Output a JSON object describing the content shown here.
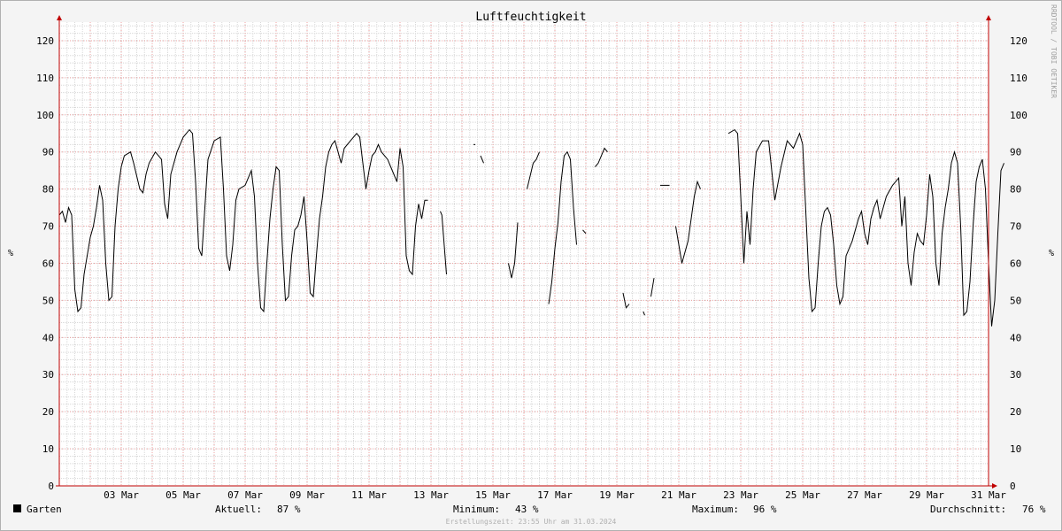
{
  "chart_data": {
    "type": "line",
    "title": "Luftfeuchtigkeit",
    "ylabel": "%",
    "ylim": [
      0,
      125
    ],
    "yticks": [
      0,
      10,
      20,
      30,
      40,
      50,
      60,
      70,
      80,
      90,
      100,
      110,
      120
    ],
    "xlim": [
      0,
      30
    ],
    "x_ticks": [
      {
        "day": 2,
        "label": "03 Mar"
      },
      {
        "day": 4,
        "label": "05 Mar"
      },
      {
        "day": 6,
        "label": "07 Mar"
      },
      {
        "day": 8,
        "label": "09 Mar"
      },
      {
        "day": 10,
        "label": "11 Mar"
      },
      {
        "day": 12,
        "label": "13 Mar"
      },
      {
        "day": 14,
        "label": "15 Mar"
      },
      {
        "day": 16,
        "label": "17 Mar"
      },
      {
        "day": 18,
        "label": "19 Mar"
      },
      {
        "day": 20,
        "label": "21 Mar"
      },
      {
        "day": 22,
        "label": "23 Mar"
      },
      {
        "day": 24,
        "label": "25 Mar"
      },
      {
        "day": 26,
        "label": "27 Mar"
      },
      {
        "day": 28,
        "label": "29 Mar"
      },
      {
        "day": 30,
        "label": "31 Mar"
      }
    ],
    "grid": true,
    "series": [
      {
        "name": "Garten",
        "color": "#000000",
        "segments": [
          [
            [
              0.0,
              73
            ],
            [
              0.1,
              74
            ],
            [
              0.2,
              71
            ],
            [
              0.3,
              75
            ],
            [
              0.4,
              73
            ],
            [
              0.5,
              53
            ],
            [
              0.6,
              47
            ],
            [
              0.7,
              48
            ],
            [
              0.8,
              57
            ],
            [
              0.9,
              62
            ],
            [
              1.0,
              67
            ],
            [
              1.1,
              70
            ],
            [
              1.2,
              75
            ],
            [
              1.3,
              81
            ],
            [
              1.4,
              77
            ],
            [
              1.5,
              60
            ],
            [
              1.6,
              50
            ],
            [
              1.7,
              51
            ],
            [
              1.8,
              70
            ],
            [
              1.9,
              80
            ],
            [
              2.0,
              86
            ],
            [
              2.1,
              89
            ],
            [
              2.3,
              90
            ],
            [
              2.4,
              87
            ],
            [
              2.6,
              80
            ],
            [
              2.7,
              79
            ],
            [
              2.8,
              84
            ],
            [
              2.9,
              87
            ],
            [
              3.1,
              90
            ],
            [
              3.3,
              88
            ],
            [
              3.4,
              76
            ],
            [
              3.5,
              72
            ],
            [
              3.6,
              84
            ],
            [
              3.8,
              90
            ],
            [
              4.0,
              94
            ],
            [
              4.2,
              96
            ],
            [
              4.3,
              95
            ],
            [
              4.4,
              82
            ],
            [
              4.5,
              64
            ],
            [
              4.6,
              62
            ],
            [
              4.7,
              75
            ],
            [
              4.8,
              88
            ],
            [
              5.0,
              93
            ],
            [
              5.2,
              94
            ],
            [
              5.3,
              80
            ],
            [
              5.4,
              62
            ],
            [
              5.5,
              58
            ],
            [
              5.6,
              65
            ],
            [
              5.7,
              77
            ],
            [
              5.8,
              80
            ],
            [
              6.0,
              81
            ],
            [
              6.2,
              85
            ],
            [
              6.3,
              78
            ],
            [
              6.4,
              60
            ],
            [
              6.5,
              48
            ],
            [
              6.6,
              47
            ],
            [
              6.7,
              60
            ],
            [
              6.8,
              72
            ],
            [
              6.9,
              80
            ],
            [
              7.0,
              86
            ],
            [
              7.1,
              85
            ],
            [
              7.2,
              65
            ],
            [
              7.3,
              50
            ],
            [
              7.4,
              51
            ],
            [
              7.5,
              62
            ],
            [
              7.6,
              69
            ],
            [
              7.7,
              70
            ],
            [
              7.8,
              73
            ],
            [
              7.9,
              78
            ],
            [
              8.0,
              66
            ],
            [
              8.1,
              52
            ],
            [
              8.2,
              51
            ],
            [
              8.3,
              62
            ],
            [
              8.4,
              72
            ],
            [
              8.5,
              78
            ],
            [
              8.6,
              86
            ],
            [
              8.7,
              90
            ],
            [
              8.8,
              92
            ],
            [
              8.9,
              93
            ],
            [
              9.0,
              90
            ],
            [
              9.1,
              87
            ],
            [
              9.2,
              91
            ],
            [
              9.4,
              93
            ],
            [
              9.6,
              95
            ],
            [
              9.7,
              94
            ],
            [
              9.8,
              87
            ],
            [
              9.9,
              80
            ],
            [
              10.0,
              85
            ],
            [
              10.1,
              89
            ],
            [
              10.2,
              90
            ],
            [
              10.3,
              92
            ],
            [
              10.4,
              90
            ],
            [
              10.6,
              88
            ],
            [
              10.7,
              86
            ],
            [
              10.8,
              84
            ],
            [
              10.9,
              82
            ],
            [
              11.0,
              91
            ],
            [
              11.1,
              86
            ],
            [
              11.2,
              62
            ],
            [
              11.3,
              58
            ],
            [
              11.4,
              57
            ],
            [
              11.5,
              70
            ],
            [
              11.6,
              76
            ],
            [
              11.7,
              72
            ],
            [
              11.8,
              77
            ],
            [
              11.9,
              77
            ]
          ],
          [
            [
              12.3,
              74
            ],
            [
              12.35,
              73
            ],
            [
              12.5,
              57
            ]
          ],
          [
            [
              13.4,
              92
            ]
          ],
          [
            [
              13.6,
              89
            ],
            [
              13.7,
              87
            ]
          ],
          [
            [
              14.5,
              60
            ],
            [
              14.6,
              56
            ],
            [
              14.7,
              60
            ],
            [
              14.8,
              71
            ]
          ],
          [
            [
              15.1,
              80
            ],
            [
              15.3,
              87
            ],
            [
              15.4,
              88
            ],
            [
              15.5,
              90
            ]
          ],
          [
            [
              15.8,
              49
            ],
            [
              15.9,
              55
            ],
            [
              16.0,
              64
            ],
            [
              16.1,
              71
            ],
            [
              16.2,
              82
            ],
            [
              16.3,
              89
            ],
            [
              16.4,
              90
            ],
            [
              16.5,
              88
            ],
            [
              16.6,
              75
            ],
            [
              16.7,
              65
            ]
          ],
          [
            [
              16.9,
              69
            ],
            [
              17.0,
              68
            ]
          ],
          [
            [
              17.3,
              86
            ],
            [
              17.4,
              87
            ],
            [
              17.5,
              89
            ],
            [
              17.6,
              91
            ],
            [
              17.7,
              90
            ]
          ],
          [
            [
              18.2,
              52
            ],
            [
              18.3,
              48
            ],
            [
              18.4,
              49
            ]
          ],
          [
            [
              18.85,
              47
            ],
            [
              18.9,
              46
            ]
          ],
          [
            [
              19.1,
              51
            ],
            [
              19.2,
              56
            ]
          ],
          [
            [
              19.4,
              81
            ],
            [
              19.6,
              81
            ],
            [
              19.7,
              81
            ]
          ],
          [
            [
              19.9,
              70
            ],
            [
              20.0,
              65
            ],
            [
              20.1,
              60
            ],
            [
              20.3,
              66
            ],
            [
              20.5,
              78
            ],
            [
              20.6,
              82
            ],
            [
              20.7,
              80
            ]
          ],
          [
            [
              21.6,
              95
            ],
            [
              21.8,
              96
            ],
            [
              21.9,
              95
            ],
            [
              22.0,
              78
            ],
            [
              22.1,
              60
            ],
            [
              22.2,
              74
            ],
            [
              22.3,
              65
            ],
            [
              22.4,
              80
            ],
            [
              22.5,
              90
            ],
            [
              22.7,
              93
            ],
            [
              22.9,
              93
            ],
            [
              23.0,
              85
            ],
            [
              23.1,
              77
            ],
            [
              23.3,
              86
            ],
            [
              23.5,
              93
            ],
            [
              23.7,
              91
            ],
            [
              23.9,
              95
            ],
            [
              24.0,
              92
            ],
            [
              24.2,
              56
            ],
            [
              24.3,
              47
            ],
            [
              24.4,
              48
            ],
            [
              24.5,
              60
            ],
            [
              24.6,
              70
            ],
            [
              24.7,
              74
            ],
            [
              24.8,
              75
            ],
            [
              24.9,
              73
            ],
            [
              25.0,
              65
            ],
            [
              25.1,
              54
            ],
            [
              25.2,
              49
            ],
            [
              25.3,
              51
            ],
            [
              25.4,
              62
            ],
            [
              25.5,
              64
            ],
            [
              25.6,
              66
            ],
            [
              25.7,
              69
            ],
            [
              25.8,
              72
            ],
            [
              25.9,
              74
            ],
            [
              26.0,
              68
            ],
            [
              26.1,
              65
            ],
            [
              26.2,
              72
            ],
            [
              26.3,
              75
            ],
            [
              26.4,
              77
            ],
            [
              26.5,
              72
            ],
            [
              26.7,
              78
            ],
            [
              26.9,
              81
            ],
            [
              27.0,
              82
            ],
            [
              27.1,
              83
            ],
            [
              27.2,
              70
            ],
            [
              27.3,
              78
            ],
            [
              27.4,
              60
            ],
            [
              27.5,
              54
            ],
            [
              27.6,
              63
            ],
            [
              27.7,
              68
            ],
            [
              27.8,
              66
            ],
            [
              27.9,
              65
            ],
            [
              28.0,
              73
            ],
            [
              28.1,
              84
            ],
            [
              28.2,
              78
            ],
            [
              28.3,
              60
            ],
            [
              28.4,
              54
            ],
            [
              28.5,
              68
            ],
            [
              28.6,
              75
            ],
            [
              28.7,
              80
            ],
            [
              28.8,
              87
            ],
            [
              28.9,
              90
            ],
            [
              29.0,
              87
            ],
            [
              29.1,
              70
            ],
            [
              29.2,
              46
            ],
            [
              29.3,
              47
            ],
            [
              29.4,
              55
            ],
            [
              29.5,
              70
            ],
            [
              29.6,
              82
            ],
            [
              29.7,
              86
            ],
            [
              29.8,
              88
            ],
            [
              29.9,
              80
            ],
            [
              30.0,
              60
            ],
            [
              30.1,
              43
            ],
            [
              30.2,
              50
            ],
            [
              30.3,
              68
            ],
            [
              30.4,
              85
            ],
            [
              30.5,
              87
            ]
          ]
        ]
      }
    ]
  },
  "watermark": "RRDTOOL / TOBI OETIKER",
  "footer": {
    "legend_name": "Garten",
    "legend_color": "#000000",
    "current_label": "Aktuell:",
    "current_value": "87 %",
    "min_label": "Minimum:",
    "min_value": "43 %",
    "max_label": "Maximum:",
    "max_value": "96 %",
    "avg_label": "Durchschnitt:",
    "avg_value": "76 %",
    "created": "Erstellungszeit: 23:55 Uhr am 31.03.2024"
  },
  "colors": {
    "background": "#f4f4f4",
    "plot_background": "#ffffff",
    "minor_grid": "#d8d8d8",
    "major_grid": "#f0a0a0",
    "axis": "#c00000"
  }
}
